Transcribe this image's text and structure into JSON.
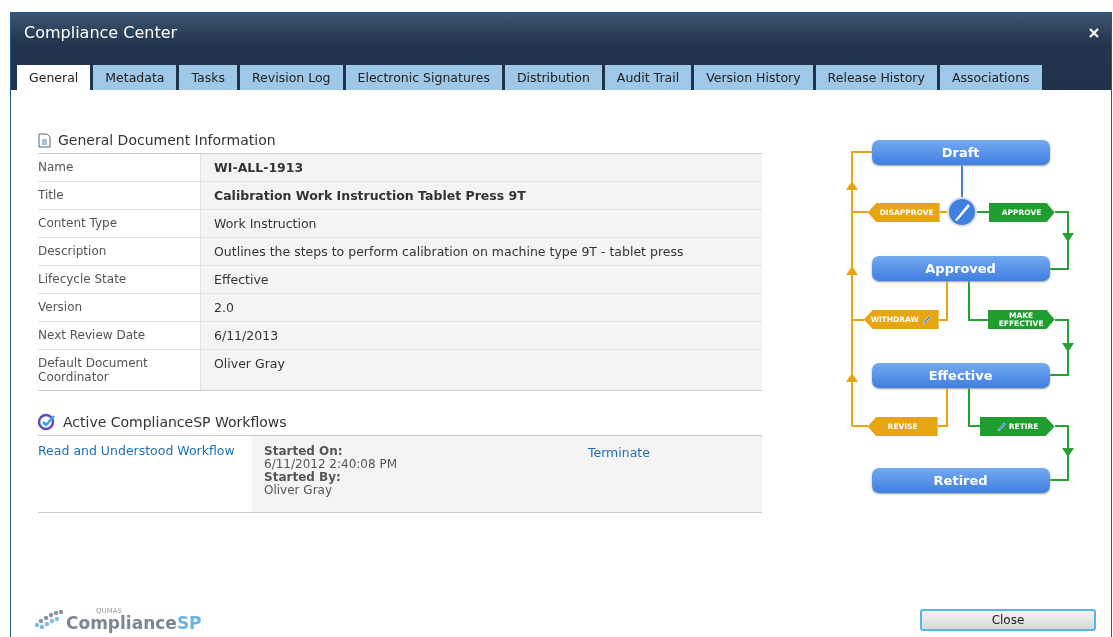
{
  "window": {
    "title": "Compliance Center"
  },
  "tabs": [
    {
      "label": "General",
      "selected": true
    },
    {
      "label": "Metadata",
      "selected": false
    },
    {
      "label": "Tasks",
      "selected": false
    },
    {
      "label": "Revision Log",
      "selected": false
    },
    {
      "label": "Electronic Signatures",
      "selected": false
    },
    {
      "label": "Distribution",
      "selected": false
    },
    {
      "label": "Audit Trail",
      "selected": false
    },
    {
      "label": "Version History",
      "selected": false
    },
    {
      "label": "Release History",
      "selected": false
    },
    {
      "label": "Associations",
      "selected": false
    }
  ],
  "document_info": {
    "heading": "General Document Information",
    "rows": [
      {
        "label": "Name",
        "value": "WI-ALL-1913",
        "bold": true
      },
      {
        "label": "Title",
        "value": "Calibration Work Instruction Tablet Press 9T",
        "bold": true
      },
      {
        "label": "Content Type",
        "value": "Work Instruction",
        "bold": false
      },
      {
        "label": "Description",
        "value": "Outlines the steps to perform calibration on machine type 9T - tablet press",
        "bold": false
      },
      {
        "label": "Lifecycle State",
        "value": "Effective",
        "bold": false
      },
      {
        "label": "Version",
        "value": "2.0",
        "bold": false
      },
      {
        "label": "Next Review Date",
        "value": "6/11/2013",
        "bold": false
      },
      {
        "label": "Default Document Coordinator",
        "value": "Oliver Gray",
        "bold": false
      }
    ]
  },
  "workflows": {
    "heading": "Active ComplianceSP Workflows",
    "items": [
      {
        "name": "Read and Understood Workflow",
        "started_on_label": "Started On:",
        "started_on": "6/11/2012 2:40:08 PM",
        "started_by_label": "Started By:",
        "started_by": "Oliver Gray",
        "action": "Terminate"
      }
    ]
  },
  "lifecycle": {
    "states": [
      "Draft",
      "Approved",
      "Effective",
      "Retired"
    ],
    "transitions": [
      {
        "label": "DISAPPROVE",
        "kind": "reject",
        "signature": false
      },
      {
        "label": "APPROVE",
        "kind": "advance",
        "signature": false
      },
      {
        "label": "WITHDRAW",
        "kind": "reject",
        "signature": true
      },
      {
        "label": "MAKE EFFECTIVE",
        "kind": "advance",
        "signature": false
      },
      {
        "label": "REVISE",
        "kind": "reject",
        "signature": false
      },
      {
        "label": "RETIRE",
        "kind": "advance",
        "signature": true
      }
    ]
  },
  "logo": {
    "small": "QUMAS",
    "main": "Compliance",
    "accent": "SP"
  },
  "buttons": [
    "Close"
  ]
}
